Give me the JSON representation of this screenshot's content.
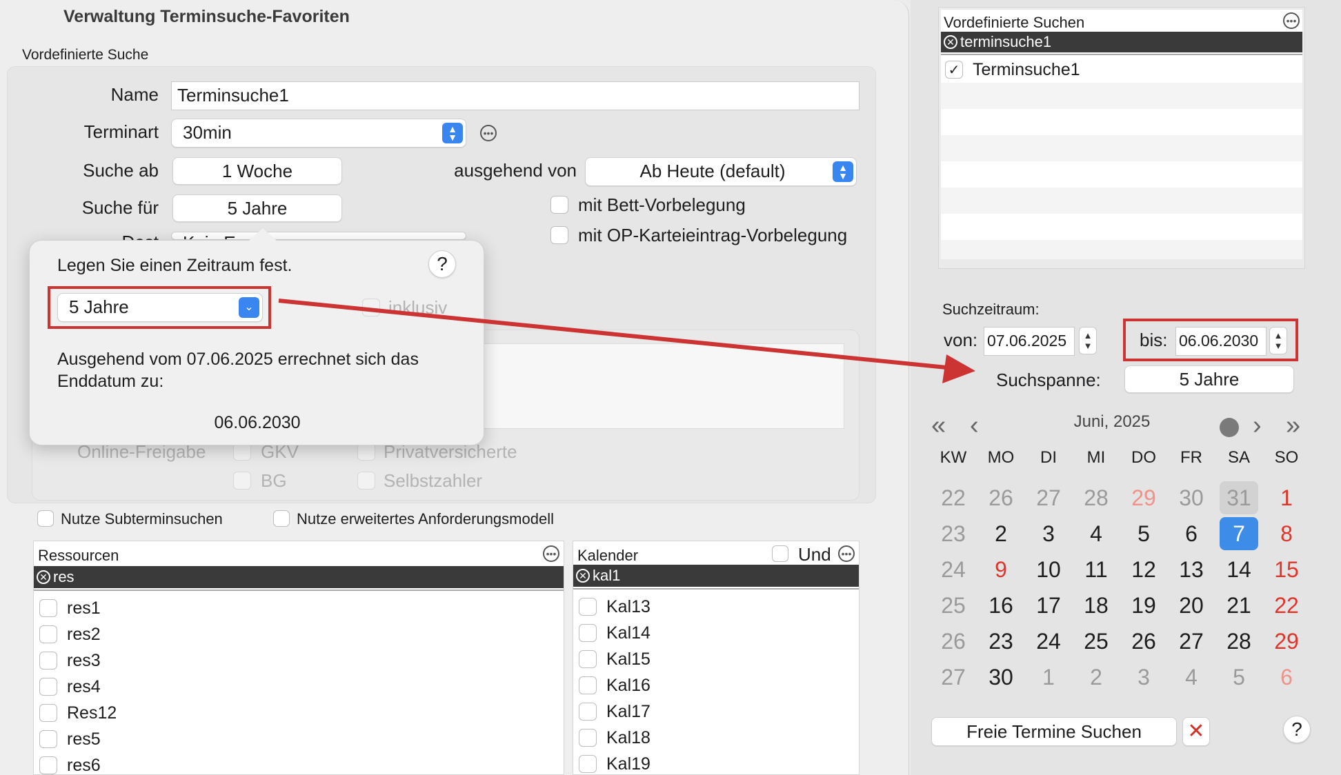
{
  "sheet": {
    "title": "Verwaltung Terminsuche-Favoriten",
    "section_label": "Vordefinierte Suche",
    "name_label": "Name",
    "name_value": "Terminsuche1",
    "terminart_label": "Terminart",
    "terminart_value": "30min",
    "suche_ab_label": "Suche ab",
    "suche_ab_value": "1 Woche",
    "ausgehend_label": "ausgehend von",
    "ausgehend_value": "Ab Heute (default)",
    "suche_fuer_label": "Suche für",
    "suche_fuer_value": "5 Jahre",
    "bett_label": "mit Bett-Vorbelegung",
    "op_label": "mit OP-Karteieintrag-Vorbelegung",
    "hidden_label_partial": "Dest",
    "hidden_popup_partial": "Kein E",
    "online_label": "Online-Freigabe",
    "gkv_label": "GKV",
    "privat_label": "Privatversicherte",
    "bg_label": "BG",
    "selbst_label": "Selbstzahler",
    "subtermin_label": "Nutze Subterminsuchen",
    "erweitert_label": "Nutze erweitertes Anforderungsmodell"
  },
  "ressourcen": {
    "title": "Ressourcen",
    "filter": "res",
    "items": [
      "res1",
      "res2",
      "res3",
      "res4",
      "Res12",
      "res5",
      "res6"
    ]
  },
  "kalender": {
    "title": "Kalender",
    "und_label": "Und",
    "filter": "kal1",
    "items": [
      "Kal13",
      "Kal14",
      "Kal15",
      "Kal16",
      "Kal17",
      "Kal18",
      "Kal19"
    ]
  },
  "popover": {
    "title": "Legen Sie einen Zeitraum fest.",
    "help": "?",
    "selected": "5 Jahre",
    "inklusiv_label": "inklusiv",
    "info_line1": "Ausgehend vom 07.06.2025 errechnet sich das",
    "info_line2": "Enddatum zu:",
    "end_date": "06.06.2030"
  },
  "right": {
    "favorites_title": "Vordefinierte Suchen",
    "favorites_filter": "terminsuche1",
    "favorites_items": [
      {
        "label": "Terminsuche1",
        "checked": true
      }
    ],
    "suchzeitraum_label": "Suchzeitraum:",
    "von_label": "von:",
    "von_value": "07.06.2025",
    "bis_label": "bis:",
    "bis_value": "06.06.2030",
    "suchspanne_label": "Suchspanne:",
    "suchspanne_value": "5 Jahre",
    "month_title": "Juni, 2025",
    "search_button": "Freie Termine Suchen",
    "help": "?"
  },
  "calendar": {
    "headers": [
      "KW",
      "MO",
      "DI",
      "MI",
      "DO",
      "FR",
      "SA",
      "SO"
    ],
    "rows": [
      [
        {
          "t": "22",
          "c": "kw"
        },
        {
          "t": "26",
          "c": "grey"
        },
        {
          "t": "27",
          "c": "grey"
        },
        {
          "t": "28",
          "c": "grey"
        },
        {
          "t": "29",
          "c": "pink"
        },
        {
          "t": "30",
          "c": "grey"
        },
        {
          "t": "31",
          "c": "today"
        },
        {
          "t": "1",
          "c": "red"
        }
      ],
      [
        {
          "t": "23",
          "c": "kw"
        },
        {
          "t": "2",
          "c": "black"
        },
        {
          "t": "3",
          "c": "black"
        },
        {
          "t": "4",
          "c": "black"
        },
        {
          "t": "5",
          "c": "black"
        },
        {
          "t": "6",
          "c": "black"
        },
        {
          "t": "7",
          "c": "sel"
        },
        {
          "t": "8",
          "c": "red"
        }
      ],
      [
        {
          "t": "24",
          "c": "kw"
        },
        {
          "t": "9",
          "c": "red"
        },
        {
          "t": "10",
          "c": "black"
        },
        {
          "t": "11",
          "c": "black"
        },
        {
          "t": "12",
          "c": "black"
        },
        {
          "t": "13",
          "c": "black"
        },
        {
          "t": "14",
          "c": "black"
        },
        {
          "t": "15",
          "c": "red"
        }
      ],
      [
        {
          "t": "25",
          "c": "kw"
        },
        {
          "t": "16",
          "c": "black"
        },
        {
          "t": "17",
          "c": "black"
        },
        {
          "t": "18",
          "c": "black"
        },
        {
          "t": "19",
          "c": "black"
        },
        {
          "t": "20",
          "c": "black"
        },
        {
          "t": "21",
          "c": "black"
        },
        {
          "t": "22",
          "c": "red"
        }
      ],
      [
        {
          "t": "26",
          "c": "kw"
        },
        {
          "t": "23",
          "c": "black"
        },
        {
          "t": "24",
          "c": "black"
        },
        {
          "t": "25",
          "c": "black"
        },
        {
          "t": "26",
          "c": "black"
        },
        {
          "t": "27",
          "c": "black"
        },
        {
          "t": "28",
          "c": "black"
        },
        {
          "t": "29",
          "c": "red"
        }
      ],
      [
        {
          "t": "27",
          "c": "kw"
        },
        {
          "t": "30",
          "c": "black"
        },
        {
          "t": "1",
          "c": "grey"
        },
        {
          "t": "2",
          "c": "grey"
        },
        {
          "t": "3",
          "c": "grey"
        },
        {
          "t": "4",
          "c": "grey"
        },
        {
          "t": "5",
          "c": "grey"
        },
        {
          "t": "6",
          "c": "pink"
        }
      ]
    ]
  },
  "colors": {
    "accent": "#3a86f0",
    "annotation_red": "#cc3333",
    "selected_day": "#3d8ce8",
    "weekend_red": "#e0352b"
  }
}
